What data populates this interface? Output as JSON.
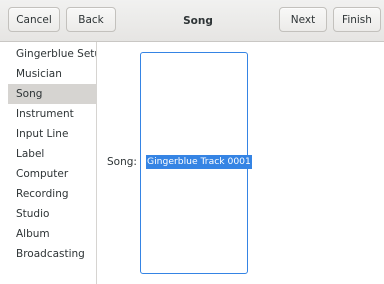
{
  "header": {
    "cancel_label": "Cancel",
    "back_label": "Back",
    "title": "Song",
    "next_label": "Next",
    "finish_label": "Finish"
  },
  "sidebar": {
    "items": [
      {
        "label": "Gingerblue Setup"
      },
      {
        "label": "Musician"
      },
      {
        "label": "Song",
        "selected": true
      },
      {
        "label": "Instrument"
      },
      {
        "label": "Input Line"
      },
      {
        "label": "Label"
      },
      {
        "label": "Computer"
      },
      {
        "label": "Recording"
      },
      {
        "label": "Studio"
      },
      {
        "label": "Album"
      },
      {
        "label": "Broadcasting"
      }
    ]
  },
  "form": {
    "song_label": "Song:",
    "song_value": "Gingerblue Track 0001"
  },
  "colors": {
    "accent": "#3584e4",
    "selected_row": "#d6d4d1"
  }
}
